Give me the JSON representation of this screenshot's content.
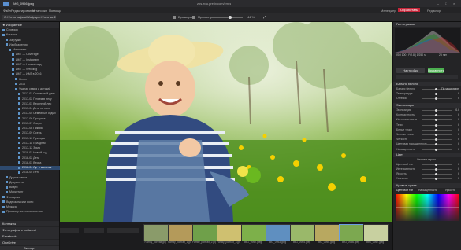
{
  "window": {
    "title": "IMG_0956.jpeg",
    "right_title": "zps.edu.prefix.com/zm-s"
  },
  "menu": [
    "Файл",
    "Редактирование",
    "Установки",
    "Помощь"
  ],
  "modes": {
    "manage": "Менеджер",
    "develop": "Обработать",
    "editor": "Редактор"
  },
  "toolbar": {
    "path": "C:\\Фотография\\Wallpaper\\Фото за 2016 год 2017 за",
    "view_label": "Брошюра",
    "sort_label": "Просмотр",
    "zoom": "44 %"
  },
  "left_panel": {
    "favorites_header": "Избранное",
    "tree": [
      {
        "label": "Сервисы",
        "count": "",
        "indent": 0,
        "sel": false
      },
      {
        "label": "Каталог",
        "count": "",
        "indent": 0,
        "sel": false
      },
      {
        "label": "Загрузки",
        "count": "",
        "indent": 1,
        "sel": false
      },
      {
        "label": "Изображения",
        "count": "",
        "indent": 1,
        "sel": false
      },
      {
        "label": "Маркетинг",
        "count": "",
        "indent": 2,
        "sel": false
      },
      {
        "label": "ИМГ — Coverage",
        "count": "",
        "indent": 3,
        "sel": false
      },
      {
        "label": "ИМГ — Instagram",
        "count": "",
        "indent": 3,
        "sel": false
      },
      {
        "label": "ИМГ — Ночной вид",
        "count": "",
        "indent": 3,
        "sel": false
      },
      {
        "label": "ИМГ — Wedding",
        "count": "",
        "indent": 3,
        "sel": false
      },
      {
        "label": "ИМГ — ИМГ в 2016",
        "count": "",
        "indent": 3,
        "sel": false
      },
      {
        "label": "Kinder",
        "count": "",
        "indent": 4,
        "sel": false
      },
      {
        "label": "2016",
        "count": "",
        "indent": 4,
        "sel": false
      },
      {
        "label": "Чудная семья и детский",
        "count": "",
        "indent": 4,
        "sel": false
      },
      {
        "label": "2017-01 Солнечный день",
        "count": "",
        "indent": 5,
        "sel": false
      },
      {
        "label": "2017-02 Гуляем в лесу",
        "count": "",
        "indent": 5,
        "sel": false
      },
      {
        "label": "2017-03 Весенний лес",
        "count": "",
        "indent": 5,
        "sel": false
      },
      {
        "label": "2017-04 Дети на поле",
        "count": "",
        "indent": 5,
        "sel": false
      },
      {
        "label": "2017-05 Семейный отдых",
        "count": "",
        "indent": 5,
        "sel": false
      },
      {
        "label": "2017-06 Прогулка",
        "count": "",
        "indent": 5,
        "sel": false
      },
      {
        "label": "2017-07 Озеро",
        "count": "",
        "indent": 5,
        "sel": false
      },
      {
        "label": "2017-08 Пикник",
        "count": "",
        "indent": 5,
        "sel": false
      },
      {
        "label": "2017-09 Осень",
        "count": "",
        "indent": 5,
        "sel": false
      },
      {
        "label": "2017-10 Природа",
        "count": "",
        "indent": 5,
        "sel": false
      },
      {
        "label": "2017-11 Праздник",
        "count": "",
        "indent": 5,
        "sel": false
      },
      {
        "label": "2017-12 Зима",
        "count": "",
        "indent": 5,
        "sel": false
      },
      {
        "label": "2018-01 Новый год",
        "count": "",
        "indent": 5,
        "sel": false
      },
      {
        "label": "2018-02 Дети",
        "count": "",
        "indent": 5,
        "sel": false
      },
      {
        "label": "2018-03 Весна",
        "count": "",
        "indent": 5,
        "sel": false
      },
      {
        "label": "2018-04 Луг и мальчик",
        "count": "",
        "indent": 5,
        "sel": true
      },
      {
        "label": "2018-05 Лето",
        "count": "",
        "indent": 5,
        "sel": false
      },
      {
        "label": "Другие папки",
        "count": "",
        "indent": 1,
        "sel": false
      },
      {
        "label": "Документы",
        "count": "",
        "indent": 1,
        "sel": false
      },
      {
        "label": "Видео",
        "count": "",
        "indent": 1,
        "sel": false
      },
      {
        "label": "Маркетинг",
        "count": "",
        "indent": 1,
        "sel": false
      },
      {
        "label": "Фотоархив",
        "count": "",
        "indent": 0,
        "sel": false
      },
      {
        "label": "Видеозаписи и фото",
        "count": "",
        "indent": 0,
        "sel": false
      },
      {
        "label": "Музыка",
        "count": "",
        "indent": 0,
        "sel": false
      },
      {
        "label": "Просмотр местоположения",
        "count": "",
        "indent": 0,
        "sel": false
      }
    ],
    "sections": [
      "Контакты",
      "Фотографии с событий",
      "Facebook",
      "OneDrive"
    ],
    "export_label": "Экспорт"
  },
  "filmstrip": {
    "thumbs": [
      "Family_portrait.jpg",
      "Family_portrait_1.jpg",
      "Family_portrait_2.jpg",
      "Family_portrait_3.jpg",
      "IMG_0952.jpeg",
      "IMG_0953.jpeg",
      "IMG_0954.jpeg",
      "IMG_0955.jpeg",
      "IMG_0956.jpeg",
      "IMG_0957.jpeg",
      "IMG_0958.jpeg",
      "IMG_0959.jpeg",
      "IMG_0960.jpeg",
      "IMG_0961.jpeg"
    ]
  },
  "right_panel": {
    "histogram_header": "Гистограмма",
    "exif": "ISO 100 | F/2.8 | 1/250 s",
    "exif2": "28 mm",
    "preset_btn": "Настройки",
    "apply_btn": "Применить",
    "wb_header": "Баланс белого",
    "wb_fields": [
      {
        "label": "Баланс белого",
        "value": "По умолчанию"
      },
      {
        "label": "Температура",
        "value": "0"
      },
      {
        "label": "Оттенок",
        "value": "0"
      }
    ],
    "exposure_header": "Экспозиция",
    "exposure_sliders": [
      {
        "label": "Экспозиция",
        "value": "0.0"
      },
      {
        "label": "Контрастность",
        "value": "0"
      },
      {
        "label": "Источники света",
        "value": "0"
      },
      {
        "label": "Тени",
        "value": "0"
      },
      {
        "label": "Белые точки",
        "value": "0"
      },
      {
        "label": "Черные точки",
        "value": "0"
      },
      {
        "label": "Четкость",
        "value": "0"
      },
      {
        "label": "Цветовая насыщенность",
        "value": "0"
      },
      {
        "label": "Насыщенность",
        "value": "0"
      }
    ],
    "color_header": "Цвет",
    "color_option": "Оттенки серого",
    "color_sliders": [
      {
        "label": "Цветовой тон",
        "value": "0"
      },
      {
        "label": "Интенсивность",
        "value": "0"
      },
      {
        "label": "Яркость",
        "value": "0"
      },
      {
        "label": "Усиление",
        "value": "0"
      }
    ],
    "curves_header": "Кривые цвета",
    "curves_tabs": [
      "Цветовой тон",
      "Насыщенность",
      "Яркость"
    ]
  }
}
